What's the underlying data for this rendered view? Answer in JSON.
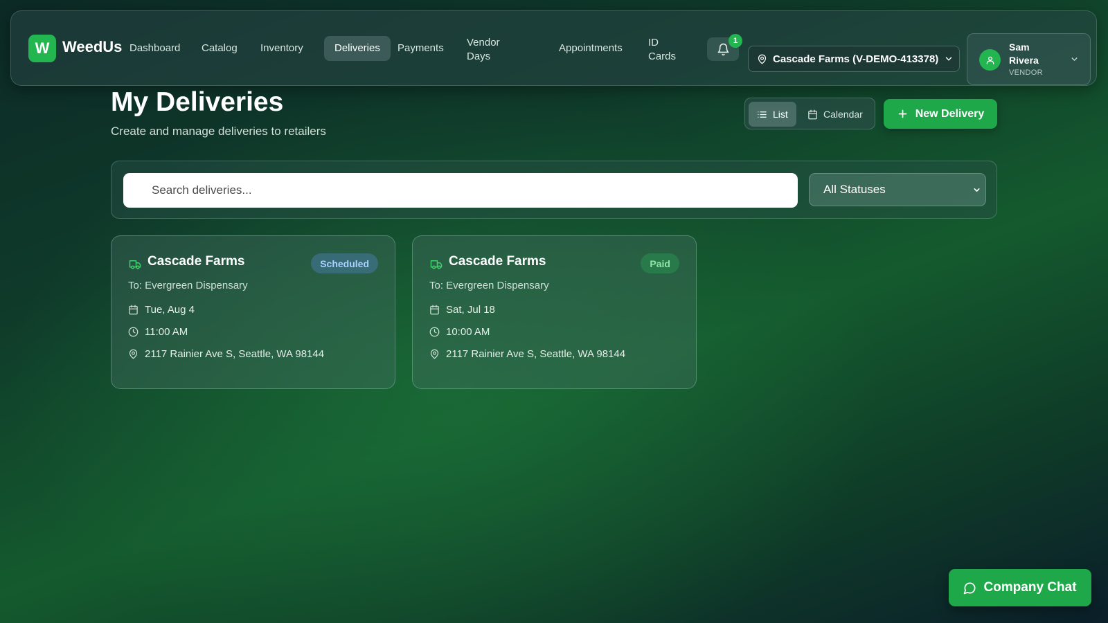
{
  "header": {
    "logo_letter": "W",
    "brand": "WeedUs",
    "nav": [
      {
        "label": "Dashboard"
      },
      {
        "label": "Catalog"
      },
      {
        "label": "Inventory"
      },
      {
        "label": "Deliveries",
        "active": true
      },
      {
        "label": "Payments"
      },
      {
        "label": "Vendor Days"
      },
      {
        "label": "Appointments"
      },
      {
        "label": "ID Cards"
      }
    ],
    "notification_count": "1",
    "store_selector": "Cascade Farms (V-DEMO-413378)",
    "user": {
      "name": "Sam Rivera",
      "role": "VENDOR"
    }
  },
  "page": {
    "title": "My Deliveries",
    "subtitle": "Create and manage deliveries to retailers",
    "view_toggle": {
      "list_label": "List",
      "calendar_label": "Calendar",
      "active": "List"
    },
    "new_button_label": "New Delivery"
  },
  "filters": {
    "search_placeholder": "Search deliveries...",
    "search_value": "",
    "status_selected": "All Statuses"
  },
  "deliveries": [
    {
      "vendor": "Cascade Farms",
      "status": "Scheduled",
      "to": "To: Evergreen Dispensary",
      "date": "Tue, Aug 4",
      "time": "11:00 AM",
      "address": "2117 Rainier Ave S, Seattle, WA 98144"
    },
    {
      "vendor": "Cascade Farms",
      "status": "Paid",
      "to": "To: Evergreen Dispensary",
      "date": "Sat, Jul 18",
      "time": "10:00 AM",
      "address": "2117 Rainier Ave S, Seattle, WA 98144"
    }
  ],
  "chat_button_label": "Company Chat",
  "colors": {
    "accent": "#1fa84a",
    "scheduled_badge_text": "#a9d2ff",
    "paid_badge_text": "#8fe6a8"
  },
  "icons": [
    "bell-icon",
    "map-pin-icon",
    "chevron-down-icon",
    "user-icon",
    "list-icon",
    "calendar-icon",
    "plus-icon",
    "truck-icon",
    "clock-icon",
    "chat-icon"
  ]
}
